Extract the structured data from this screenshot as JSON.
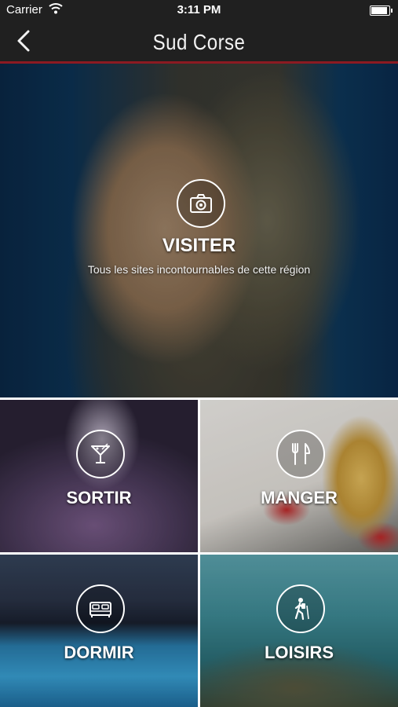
{
  "status_bar": {
    "carrier": "Carrier",
    "time": "3:11 PM",
    "battery_level": 1.0
  },
  "nav": {
    "title": "Sud Corse",
    "back_icon": "chevron-left-icon"
  },
  "tiles": {
    "visiter": {
      "label": "VISITER",
      "subtitle": "Tous les sites incontournables de cette région",
      "icon": "camera-icon"
    },
    "sortir": {
      "label": "SORTIR",
      "icon": "cocktail-icon"
    },
    "manger": {
      "label": "MANGER",
      "icon": "fork-knife-icon"
    },
    "dormir": {
      "label": "DORMIR",
      "icon": "bed-icon"
    },
    "loisirs": {
      "label": "LOISIRS",
      "icon": "hiker-icon"
    }
  },
  "colors": {
    "bar": "#202020",
    "accent": "#8c1a22"
  }
}
